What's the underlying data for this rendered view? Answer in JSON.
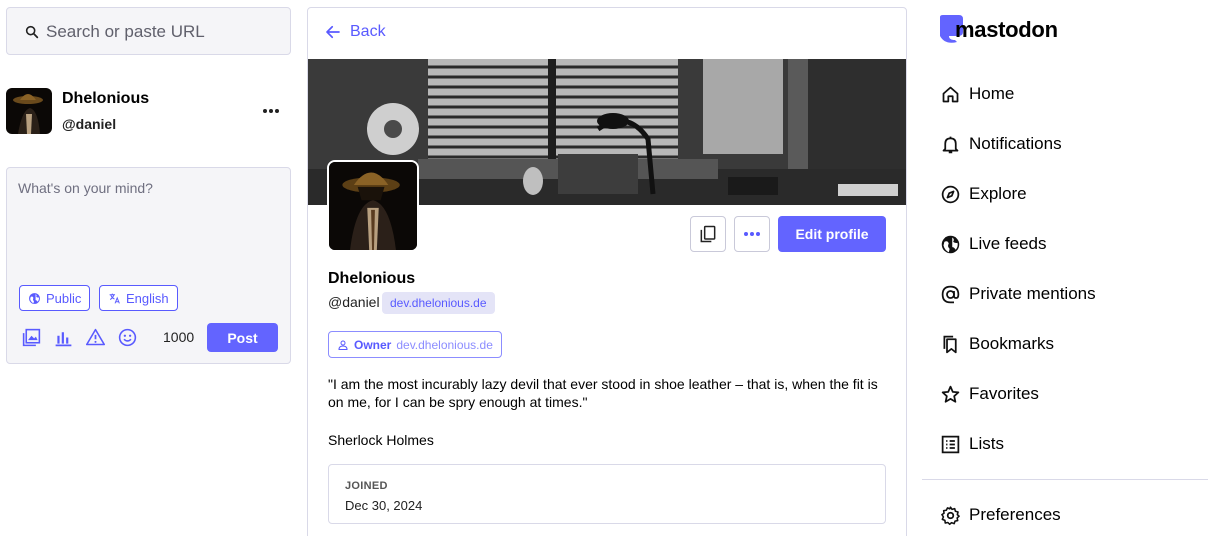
{
  "search": {
    "placeholder": "Search or paste URL"
  },
  "account": {
    "display_name": "Dhelonious",
    "handle": "@daniel"
  },
  "composer": {
    "placeholder": "What's on your mind?",
    "visibility": "Public",
    "language": "English",
    "char_count": "1000",
    "post_label": "Post",
    "tool_icons": [
      "media-icon",
      "poll-icon",
      "content-warning-icon",
      "emoji-icon"
    ]
  },
  "profile": {
    "back_label": "Back",
    "display_name": "Dhelonious",
    "handle": "@daniel",
    "domain": "dev.dhelonious.de",
    "edit_label": "Edit profile",
    "role_label": "Owner",
    "role_domain": "dev.dhelonious.de",
    "bio_quote": "\"I am the most incurably lazy devil that ever stood in shoe leather – that is, when the fit is on me, for I can be spry enough at times.\"",
    "bio_author": "Sherlock Holmes",
    "joined_label": "JOINED",
    "joined_date": "Dec 30, 2024"
  },
  "brand": {
    "name": "mastodon"
  },
  "nav": {
    "items": [
      {
        "label": "Home",
        "icon": "home-icon"
      },
      {
        "label": "Notifications",
        "icon": "bell-icon"
      },
      {
        "label": "Explore",
        "icon": "compass-icon"
      },
      {
        "label": "Live feeds",
        "icon": "globe-icon"
      },
      {
        "label": "Private mentions",
        "icon": "at-icon"
      },
      {
        "label": "Bookmarks",
        "icon": "bookmark-icon"
      },
      {
        "label": "Favorites",
        "icon": "star-icon"
      },
      {
        "label": "Lists",
        "icon": "list-icon"
      },
      {
        "label": "Preferences",
        "icon": "gear-icon"
      }
    ]
  },
  "colors": {
    "accent": "#6364ff",
    "link": "#595aff",
    "border": "#d9d9e8"
  }
}
